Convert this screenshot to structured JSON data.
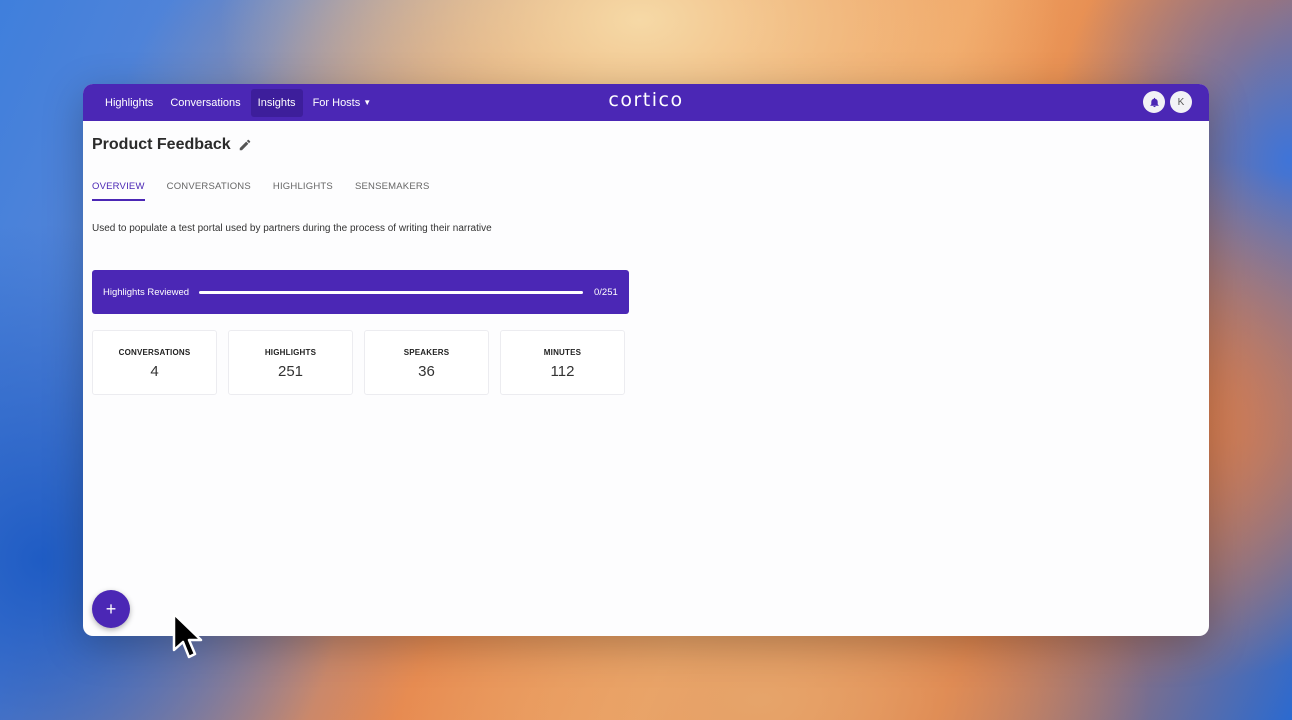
{
  "nav": {
    "items": [
      {
        "label": "Highlights",
        "active": false
      },
      {
        "label": "Conversations",
        "active": false
      },
      {
        "label": "Insights",
        "active": true
      },
      {
        "label": "For Hosts",
        "active": false,
        "dropdown": true
      }
    ]
  },
  "brand": {
    "logo_text": "cortico",
    "color": "#4b27b5"
  },
  "user": {
    "avatar_initial": "K"
  },
  "icons": {
    "notifications": "bell-icon",
    "edit": "pencil-icon",
    "fab": "plus-icon",
    "dropdown": "caret-down-icon"
  },
  "page": {
    "title": "Product Feedback",
    "tabs": [
      {
        "label": "OVERVIEW",
        "active": true
      },
      {
        "label": "CONVERSATIONS",
        "active": false
      },
      {
        "label": "HIGHLIGHTS",
        "active": false
      },
      {
        "label": "SENSEMAKERS",
        "active": false
      }
    ],
    "description": "Used to populate a test portal used by partners during the process of writing their narrative"
  },
  "progress": {
    "label": "Highlights Reviewed",
    "count_text": "0/251",
    "reviewed": 0,
    "total": 251
  },
  "stats": [
    {
      "label": "CONVERSATIONS",
      "value": "4"
    },
    {
      "label": "HIGHLIGHTS",
      "value": "251"
    },
    {
      "label": "SPEAKERS",
      "value": "36"
    },
    {
      "label": "MINUTES",
      "value": "112"
    }
  ],
  "fab": {
    "symbol": "+"
  }
}
